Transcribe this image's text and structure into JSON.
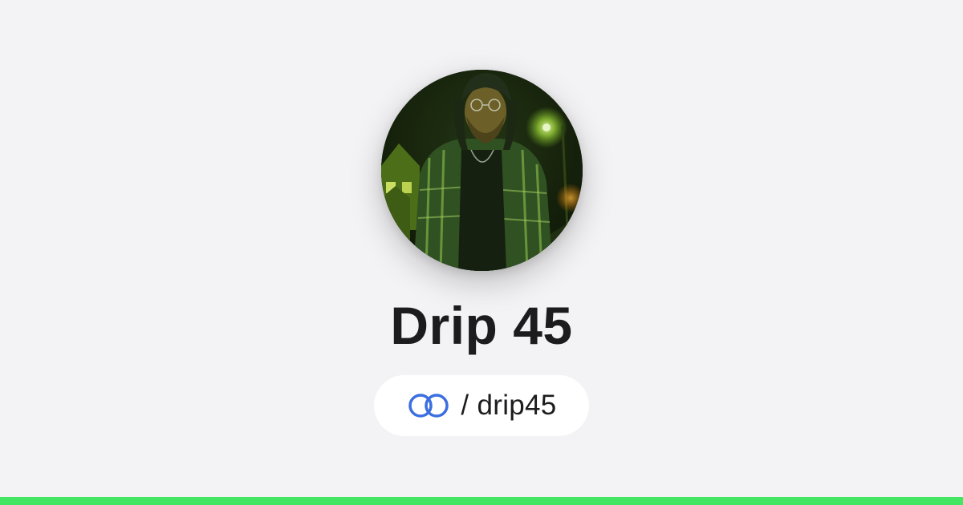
{
  "profile": {
    "display_name": "Drip 45",
    "handle": "/ drip45",
    "avatar_icon": "profile-photo"
  },
  "brand": {
    "link_icon": "linked-rings-icon",
    "link_icon_color": "#3b6fe0",
    "accent_bar_color": "#43e660"
  },
  "colors": {
    "background": "#f3f3f5",
    "text": "#1c1c1e",
    "pill_background": "#ffffff"
  }
}
